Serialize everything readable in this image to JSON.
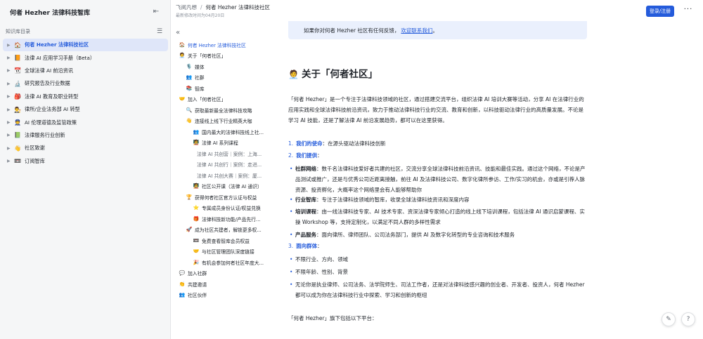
{
  "sidebar": {
    "title": "何者 Hezher 法律科技智库",
    "section_label": "知识库目录",
    "items": [
      {
        "icon": "🏠",
        "label": "何者 Hezher 法律科技社区",
        "active": true
      },
      {
        "icon": "📙",
        "label": "法律 AI 应用学习手册（Beta）",
        "active": false
      },
      {
        "icon": "📆",
        "label": "全球法律 AI 前沿资讯",
        "active": false
      },
      {
        "icon": "🔬",
        "label": "研究报告及行业数据",
        "active": false
      },
      {
        "icon": "🎒",
        "label": "法律 AI 教育及职业转型",
        "active": false
      },
      {
        "icon": "👨‍⚖️",
        "label": "律所/企业法务部 AI 转型",
        "active": false
      },
      {
        "icon": "👮",
        "label": "AI 伦理道德及监管政策",
        "active": false
      },
      {
        "icon": "📗",
        "label": "法律服务行业创新",
        "active": false
      },
      {
        "icon": "👋",
        "label": "社区致谢",
        "active": false
      },
      {
        "icon": "📼",
        "label": "订阅智库",
        "active": false
      }
    ]
  },
  "topbar": {
    "crumb_parent": "飞阅凡想",
    "crumb_current": "何者 Hezher 法律科技社区",
    "updated": "最新修改时间为04月20日",
    "login_label": "登录/注册",
    "more_label": "···"
  },
  "outline": {
    "items": [
      {
        "level": 1,
        "icon": "🏠",
        "label": "何者 Hezher 法律科技社区",
        "active": true
      },
      {
        "level": 1,
        "icon": "🧑‍💼",
        "label": "关于「何者社区」",
        "active": false
      },
      {
        "level": 2,
        "icon": "🎙️",
        "label": "媒体",
        "active": false
      },
      {
        "level": 2,
        "icon": "👥",
        "label": "社群",
        "active": false
      },
      {
        "level": 2,
        "icon": "📚",
        "label": "智库",
        "active": false
      },
      {
        "level": 1,
        "icon": "🤝",
        "label": "加入「何者社区」",
        "active": false
      },
      {
        "level": 2,
        "icon": "🔍",
        "label": "获取最新最全法律科技攻略",
        "active": false
      },
      {
        "level": 2,
        "icon": "👋",
        "label": "连接线上线下行业精英大咖",
        "active": false
      },
      {
        "level": 3,
        "icon": "👥",
        "label": "国内最大的法律科技线上社...",
        "active": false
      },
      {
        "level": 3,
        "icon": "🧑‍🏫",
        "label": "法律 AI 系列课程",
        "active": false
      },
      {
        "level": 4,
        "icon": "",
        "label": "法律 AI 共创营｜案例：上海...",
        "active": false
      },
      {
        "level": 4,
        "icon": "",
        "label": "法律 AI 共创行｜案例：走进...",
        "active": false
      },
      {
        "level": 4,
        "icon": "",
        "label": "法律 AI 共创大赛｜案例：厦...",
        "active": false
      },
      {
        "level": 3,
        "icon": "🧑‍🏫",
        "label": "社区公开课（法律 AI 通识）",
        "active": false
      },
      {
        "level": 2,
        "icon": "🏆",
        "label": "获得何者社区官方认证与权益",
        "active": false
      },
      {
        "level": 3,
        "icon": "⭐",
        "label": "专属成员身份认证/权益兑换",
        "active": false
      },
      {
        "level": 3,
        "icon": "🎁",
        "label": "法律科技新功能/产品先行...",
        "active": false
      },
      {
        "level": 2,
        "icon": "🚀",
        "label": "成为社区共建者，解锁更多权...",
        "active": false
      },
      {
        "level": 3,
        "icon": "📼",
        "label": "免费查看智库会员权益",
        "active": false
      },
      {
        "level": 3,
        "icon": "🤝",
        "label": "与社区管理团队深度链接",
        "active": false
      },
      {
        "level": 3,
        "icon": "🎉",
        "label": "有机会参加何者社区年度大...",
        "active": false
      },
      {
        "level": 1,
        "icon": "💬",
        "label": "加入社群",
        "active": false
      },
      {
        "level": 1,
        "icon": "👏",
        "label": "共建邀请",
        "active": false
      },
      {
        "level": 1,
        "icon": "👥",
        "label": "社区伙伴",
        "active": false
      }
    ]
  },
  "content": {
    "callout_text": "如果你对何者 Hezher 社区有任何反馈，",
    "callout_link": "欢迎联系我们",
    "callout_tail": "。",
    "heading_icon": "🧑‍💼",
    "heading": "关于「何者社区」",
    "intro": "「何者 Hezher」是一个专注于法律科技领域的社区，通过搭建交流平台，组织法律 AI 培训大赛等活动，分享 AI 在法律行业的应用实践和全球法律科技前沿资讯，致力于推动法律科技行业的交流、教育和创新，以科技驱动法律行业的高质量发展。不论是学习 AI 技能，还是了解法律 AI 前沿发展趋势，都可以在这里获得。",
    "mission_num": "1.",
    "mission_key": "我们的使命",
    "mission_text": "：在源头驱动法律科技创新",
    "provide_num": "2.",
    "provide_key": "我们提供",
    "provide_colon": "：",
    "bullets1": [
      {
        "key": "社群网络",
        "text": "：数千名法律科技爱好者共建的社区，交流分享全球法律科技前沿资讯、技能和最佳实践。通过这个网络，不论是产品测试或推广，还是与优秀公司近距离接触，前往 AI 及法律科技公司、数字化律所参访、工作/实习的机会，亦或是引荐人脉资源、投资孵化，大概率这个网络里会有人能够帮助你"
      },
      {
        "key": "行业智库",
        "text": "：专注于法律科技领域的智库，收录全球法律科技资讯和深度内容"
      },
      {
        "key": "培训课程",
        "text": "：由一线法律科技专家、AI 技术专家、资深法律专家倾心打造的线上线下培训课程，包括法律 AI 通识启蒙课程、实操 Workshop 等，支持定制化，以满足不同人群的多样性需求"
      },
      {
        "key": "产品服务",
        "text": "：面向律所、律师团队、公司法务部门，提供 AI 及数字化转型的专业咨询和技术服务"
      }
    ],
    "audience_num": "3.",
    "audience_key": "面向群体",
    "audience_colon": "：",
    "bullets2": [
      {
        "text": "不限行业、方向、领域"
      },
      {
        "text": "不限年龄、性别、背景"
      },
      {
        "text": "无论你是执业律师、公司法务、法学院师生、司法工作者，还是对法律科技感兴趣的创业者、开发者、投资人，何者 Hezher 都可以成为你在法律科技行业中探索、学习和创新的枢纽"
      }
    ],
    "closing": "「何者 Hezher」旗下包括以下平台："
  },
  "fab": {
    "edit_icon": "✎",
    "help_icon": "?"
  }
}
